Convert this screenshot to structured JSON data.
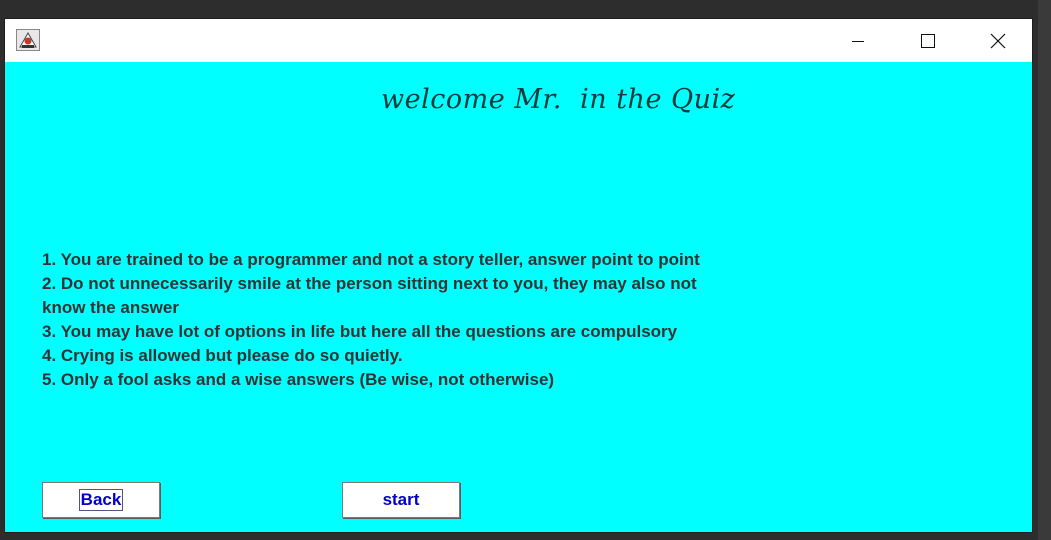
{
  "window": {
    "title": "",
    "controls": {
      "minimize_icon": "minimize-icon",
      "maximize_icon": "maximize-icon",
      "close_icon": "close-icon"
    },
    "app_icon": "java-app-icon",
    "background_color": "#00ffff"
  },
  "content": {
    "welcome_text": "welcome Mr.  in the Quiz",
    "rules": [
      "1. You are trained to be a programmer and not a story teller, answer point to point",
      "2. Do not unnecessarily smile at the person sitting next to you, they may also not know the answer",
      "3. You may have lot of options in life but here all the questions are compulsory",
      "4. Crying is allowed but please do so quietly.",
      "5. Only a fool asks and a wise answers (Be wise, not otherwise)"
    ]
  },
  "buttons": {
    "back_label": "Back",
    "start_label": "start",
    "label_color": "#0000cc"
  }
}
